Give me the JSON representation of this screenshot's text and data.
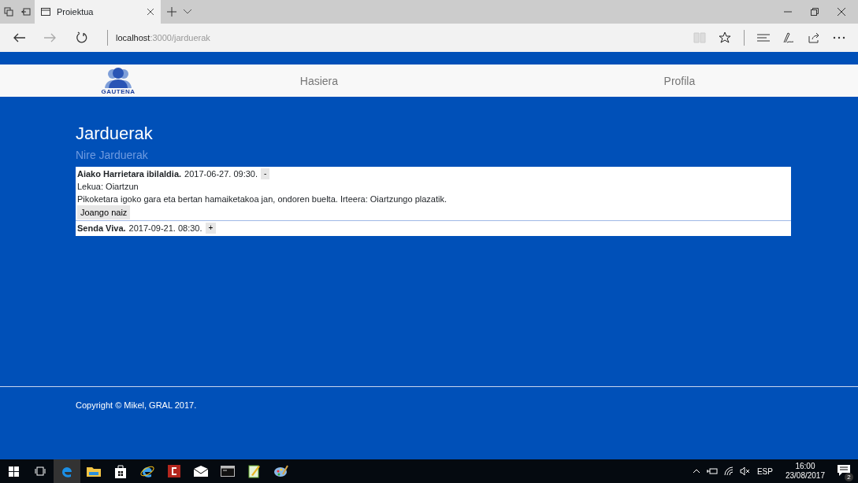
{
  "browser": {
    "tab_title": "Proiektua",
    "url_host": "localhost",
    "url_path": ":3000/jarduerak"
  },
  "navbar": {
    "logo_text": "GAUTENA",
    "links": [
      {
        "label": "Hasiera"
      },
      {
        "label": "Profila"
      }
    ]
  },
  "page": {
    "title": "Jarduerak",
    "subtitle": "Nire Jarduerak"
  },
  "activities": [
    {
      "title": "Aiako Harrietara ibilaldia.",
      "datetime": "2017-06-27. 09:30.",
      "toggle": "-",
      "expanded": true,
      "location": "Lekua: Oiartzun",
      "description": "Pikoketara igoko gara eta bertan hamaiketakoa jan, ondoren buelta. Irteera: Oiartzungo plazatik.",
      "action": "Joango naiz"
    },
    {
      "title": "Senda Viva.",
      "datetime": "2017-09-21. 08:30.",
      "toggle": "+",
      "expanded": false
    }
  ],
  "footer": {
    "text": "Copyright © Mikel, GRAL 2017."
  },
  "taskbar": {
    "language": "ESP",
    "time": "16:00",
    "date": "23/08/2017",
    "notifications": "2"
  }
}
